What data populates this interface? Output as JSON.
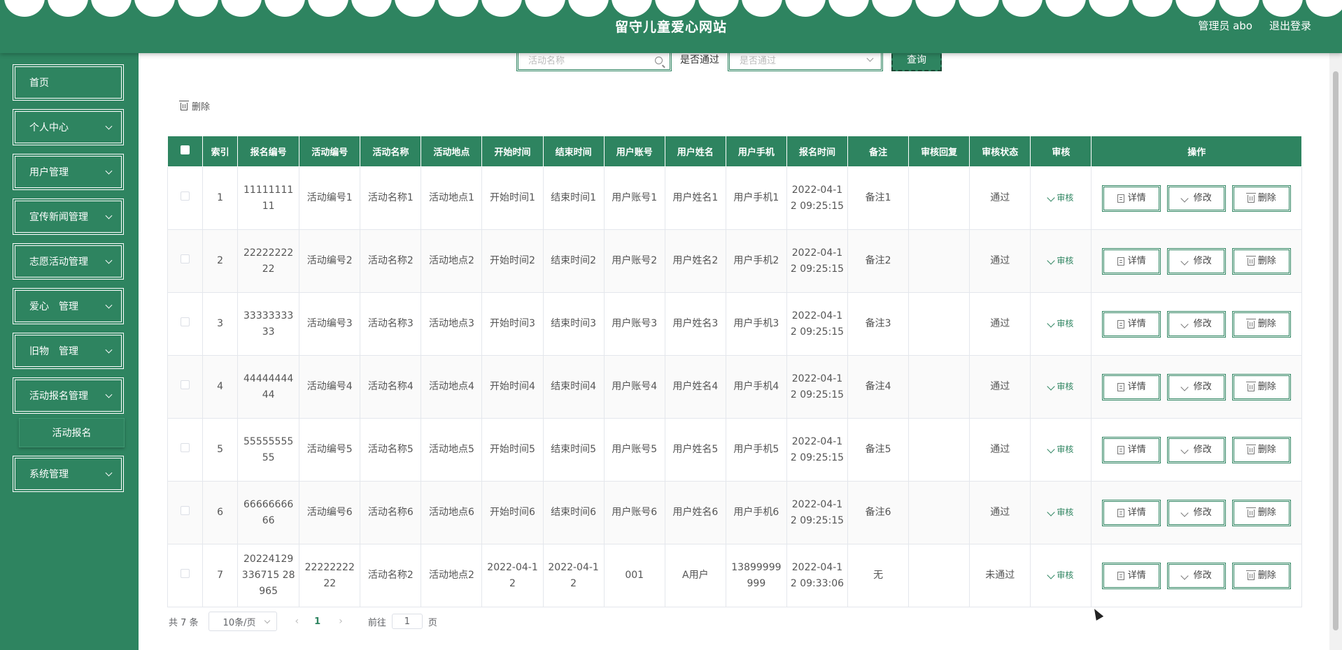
{
  "header": {
    "title": "留守儿童爱心网站",
    "user_label": "管理员 abo",
    "logout_label": "退出登录",
    "color": "#2e8460"
  },
  "sidebar": {
    "items": [
      {
        "label": "首页",
        "has_children": false
      },
      {
        "label": "个人中心",
        "has_children": true
      },
      {
        "label": "用户管理",
        "has_children": true
      },
      {
        "label": "宣传新闻管理",
        "has_children": true
      },
      {
        "label": "志愿活动管理",
        "has_children": true
      },
      {
        "label": "爱心　管理",
        "has_children": true
      },
      {
        "label": "旧物　管理",
        "has_children": true
      },
      {
        "label": "活动报名管理",
        "has_children": true,
        "expanded": true
      },
      {
        "label": "系统管理",
        "has_children": true
      }
    ],
    "submenu": {
      "label": "活动报名"
    }
  },
  "search": {
    "activity_name_placeholder": "活动名称",
    "approved_label": "是否通过",
    "approved_placeholder": "是否通过",
    "query_label": "查询"
  },
  "toolbar": {
    "delete_label": "删除"
  },
  "table": {
    "headers": [
      "",
      "索引",
      "报名编号",
      "活动编号",
      "活动名称",
      "活动地点",
      "开始时间",
      "结束时间",
      "用户账号",
      "用户姓名",
      "用户手机",
      "报名时间",
      "备注",
      "审核回复",
      "审核状态",
      "审核",
      "操作"
    ],
    "audit_link": "审核",
    "action_labels": {
      "detail": "详情",
      "edit": "修改",
      "delete": "删除"
    },
    "rows": [
      {
        "index": "1",
        "reg_no": "1111111111",
        "act_no": "活动编号1",
        "act_name": "活动名称1",
        "location": "活动地点1",
        "start": "开始时间1",
        "end": "结束时间1",
        "account": "用户账号1",
        "name": "用户姓名1",
        "phone": "用户手机1",
        "reg_time": "2022-04-12 09:25:15",
        "remark": "备注1",
        "reply": "",
        "status": "通过"
      },
      {
        "index": "2",
        "reg_no": "2222222222",
        "act_no": "活动编号2",
        "act_name": "活动名称2",
        "location": "活动地点2",
        "start": "开始时间2",
        "end": "结束时间2",
        "account": "用户账号2",
        "name": "用户姓名2",
        "phone": "用户手机2",
        "reg_time": "2022-04-12 09:25:15",
        "remark": "备注2",
        "reply": "",
        "status": "通过"
      },
      {
        "index": "3",
        "reg_no": "3333333333",
        "act_no": "活动编号3",
        "act_name": "活动名称3",
        "location": "活动地点3",
        "start": "开始时间3",
        "end": "结束时间3",
        "account": "用户账号3",
        "name": "用户姓名3",
        "phone": "用户手机3",
        "reg_time": "2022-04-12 09:25:15",
        "remark": "备注3",
        "reply": "",
        "status": "通过"
      },
      {
        "index": "4",
        "reg_no": "4444444444",
        "act_no": "活动编号4",
        "act_name": "活动名称4",
        "location": "活动地点4",
        "start": "开始时间4",
        "end": "结束时间4",
        "account": "用户账号4",
        "name": "用户姓名4",
        "phone": "用户手机4",
        "reg_time": "2022-04-12 09:25:15",
        "remark": "备注4",
        "reply": "",
        "status": "通过"
      },
      {
        "index": "5",
        "reg_no": "5555555555",
        "act_no": "活动编号5",
        "act_name": "活动名称5",
        "location": "活动地点5",
        "start": "开始时间5",
        "end": "结束时间5",
        "account": "用户账号5",
        "name": "用户姓名5",
        "phone": "用户手机5",
        "reg_time": "2022-04-12 09:25:15",
        "remark": "备注5",
        "reply": "",
        "status": "通过"
      },
      {
        "index": "6",
        "reg_no": "6666666666",
        "act_no": "活动编号6",
        "act_name": "活动名称6",
        "location": "活动地点6",
        "start": "开始时间6",
        "end": "结束时间6",
        "account": "用户账号6",
        "name": "用户姓名6",
        "phone": "用户手机6",
        "reg_time": "2022-04-12 09:25:15",
        "remark": "备注6",
        "reply": "",
        "status": "通过"
      },
      {
        "index": "7",
        "reg_no": "20224129336715 28965",
        "act_no": "2222222222",
        "act_name": "活动名称2",
        "location": "活动地点2",
        "start": "2022-04-12",
        "end": "2022-04-12",
        "account": "001",
        "name": "A用户",
        "phone": "13899999999",
        "reg_time": "2022-04-12 09:33:06",
        "remark": "无",
        "reply": "",
        "status": "未通过"
      }
    ]
  },
  "pagination": {
    "total": "共 7 条",
    "page_size": "10条/页",
    "current_page": "1",
    "goto_prefix": "前往",
    "goto_value": "1",
    "goto_suffix": "页"
  }
}
